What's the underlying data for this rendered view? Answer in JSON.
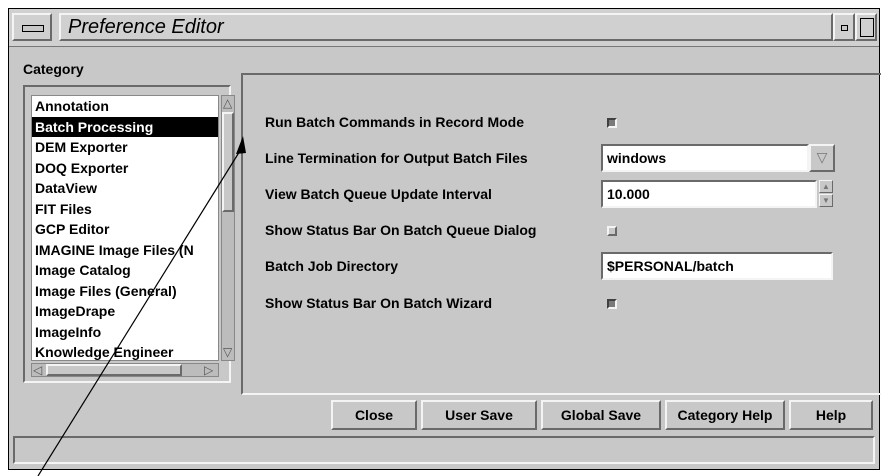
{
  "window": {
    "title": "Preference Editor"
  },
  "category": {
    "label": "Category",
    "items": [
      {
        "label": "Annotation",
        "selected": false
      },
      {
        "label": "Batch Processing",
        "selected": true
      },
      {
        "label": "DEM Exporter",
        "selected": false
      },
      {
        "label": "DOQ Exporter",
        "selected": false
      },
      {
        "label": "DataView",
        "selected": false
      },
      {
        "label": "FIT Files",
        "selected": false
      },
      {
        "label": "GCP Editor",
        "selected": false
      },
      {
        "label": "IMAGINE Image Files (N",
        "selected": false
      },
      {
        "label": "Image Catalog",
        "selected": false
      },
      {
        "label": "Image Files (General)",
        "selected": false
      },
      {
        "label": "ImageDrape",
        "selected": false
      },
      {
        "label": "ImageInfo",
        "selected": false
      },
      {
        "label": "Knowledge Engineer",
        "selected": false
      }
    ]
  },
  "prefs": {
    "run_batch_record": {
      "label": "Run Batch Commands in Record Mode",
      "checked": true
    },
    "line_termination": {
      "label": "Line Termination for Output Batch Files",
      "value": "windows"
    },
    "queue_interval": {
      "label": "View Batch Queue Update Interval",
      "value": "10.000"
    },
    "status_bar_queue": {
      "label": "Show Status Bar On Batch Queue Dialog",
      "checked": false
    },
    "job_directory": {
      "label": "Batch Job Directory",
      "value": "$PERSONAL/batch"
    },
    "status_bar_wizard": {
      "label": "Show Status Bar On Batch Wizard",
      "checked": true
    }
  },
  "buttons": {
    "close": "Close",
    "user_save": "User Save",
    "global_save": "Global Save",
    "category_help": "Category Help",
    "help": "Help"
  },
  "status": {
    "text": ""
  }
}
